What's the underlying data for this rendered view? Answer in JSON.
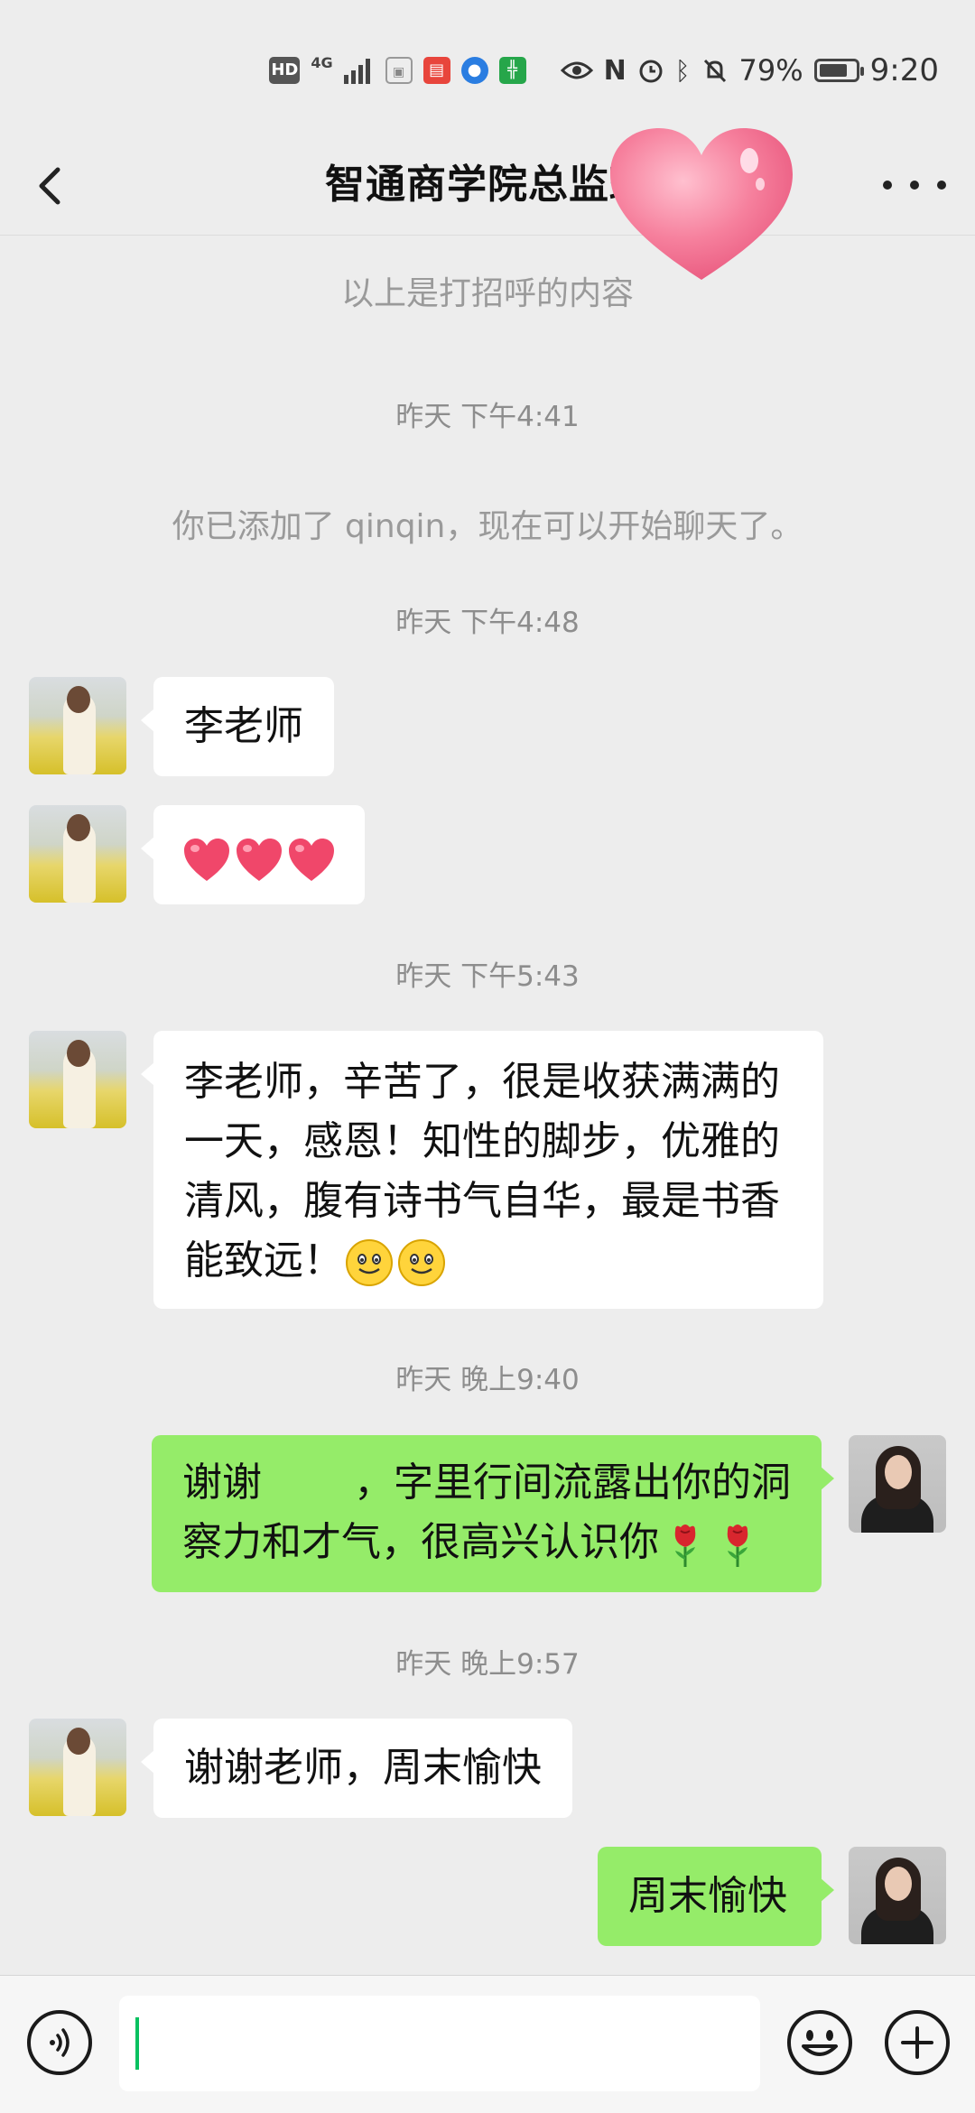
{
  "status_bar": {
    "hd": "HD",
    "network": "4G",
    "battery_percent": "79%",
    "battery_level": 0.79,
    "time": "9:20"
  },
  "header": {
    "title": "智通商学院总监班"
  },
  "chat": {
    "greeting_note": "以上是打招呼的内容",
    "messages": [
      {
        "kind": "time",
        "text": "昨天 下午4:41"
      },
      {
        "kind": "system",
        "text": "你已添加了 qinqin，现在可以开始聊天了。"
      },
      {
        "kind": "time",
        "text": "昨天 下午4:48"
      },
      {
        "kind": "incoming",
        "text": "李老师"
      },
      {
        "kind": "incoming",
        "emoji": [
          "heart",
          "heart",
          "heart"
        ]
      },
      {
        "kind": "time",
        "text": "昨天 下午5:43"
      },
      {
        "kind": "incoming",
        "lines": [
          "李老师，辛苦了，很是收获满满的",
          "一天，感恩！知性的脚步，优雅的",
          "清风，腹有诗书气自华，最是书香",
          "能致远！"
        ],
        "emoji": [
          "smile",
          "smile"
        ]
      },
      {
        "kind": "time",
        "text": "昨天 晚上9:40"
      },
      {
        "kind": "outgoing",
        "lines": [
          "谢谢 　　，字里行间流露出你的洞",
          "察力和才气，很高兴认识你"
        ],
        "emoji": [
          "rose",
          "rose"
        ]
      },
      {
        "kind": "time",
        "text": "昨天 晚上9:57"
      },
      {
        "kind": "incoming",
        "text": "谢谢老师，周末愉快"
      },
      {
        "kind": "outgoing",
        "text": "周末愉快"
      }
    ]
  },
  "colors": {
    "background": "#ededed",
    "outgoing_bubble": "#95ec69",
    "incoming_bubble": "#ffffff",
    "accent": "#07c160"
  },
  "icons": [
    "back-arrow-icon",
    "more-icon",
    "heart-sticker",
    "voice-icon",
    "emoji-icon",
    "plus-icon"
  ]
}
